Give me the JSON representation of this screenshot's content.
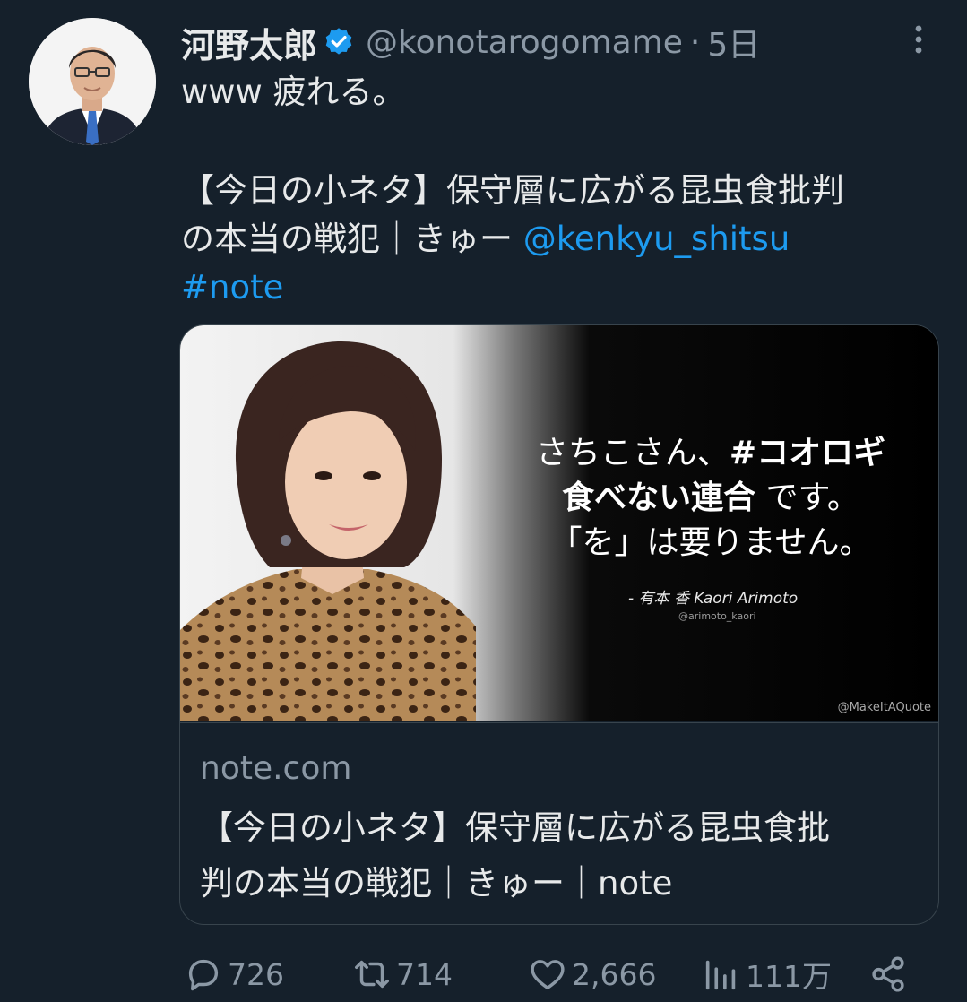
{
  "author": {
    "display_name": "河野太郎",
    "handle": "@konotarogomame",
    "separator": "·",
    "time": "5日"
  },
  "tweet": {
    "line1": "www 疲れる。",
    "line2": "【今日の小ネタ】保守層に広がる昆虫食批判",
    "line3_text": "の本当の戦犯｜きゅー ",
    "line3_mention": "@kenkyu_shitsu",
    "hashtag": "#note"
  },
  "card": {
    "quote_line1_a": "さちこさん、",
    "quote_line1_b": "#コオロギ",
    "quote_line2_a": "食べない連合",
    "quote_line2_b": " です。",
    "quote_line3": "「を」は要りません。",
    "quote_author": "- 有本 香 Kaori Arimoto",
    "quote_handle": "@arimoto_kaori",
    "watermark": "@MakeItAQuote",
    "domain": "note.com",
    "title_line1": "【今日の小ネタ】保守層に広がる昆虫食批",
    "title_line2": "判の本当の戦犯｜きゅー｜note"
  },
  "actions": {
    "replies": "726",
    "retweets": "714",
    "likes": "2,666",
    "views": "111万"
  },
  "icons": {
    "verified": "verified-badge-icon",
    "more": "more-vertical-icon",
    "reply": "reply-icon",
    "retweet": "retweet-icon",
    "like": "heart-icon",
    "views": "views-chart-icon",
    "share": "share-icon"
  },
  "colors": {
    "background": "#15202b",
    "text": "#e7e9ea",
    "muted": "#8b98a5",
    "link": "#1d9bf0",
    "border": "#38444d"
  }
}
